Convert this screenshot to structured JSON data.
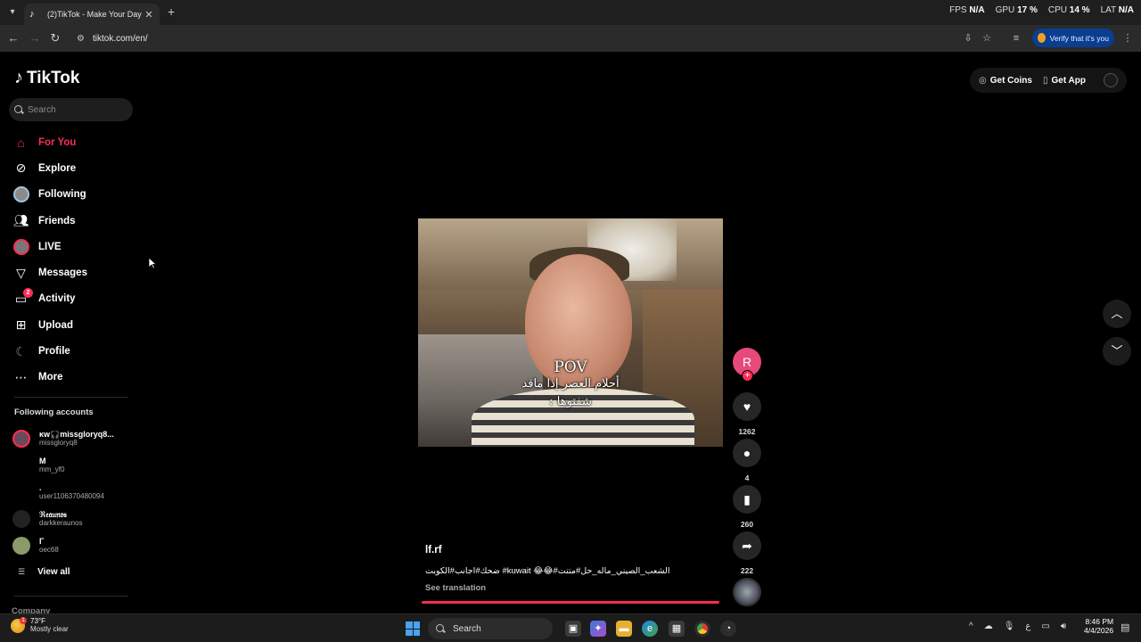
{
  "browser": {
    "tab_title": "(2)TikTok - Make Your Day",
    "url": "tiktok.com/en/",
    "verify_label": "Verify that it's you",
    "perf": [
      {
        "label": "FPS",
        "value": "N/A"
      },
      {
        "label": "GPU",
        "value": "17 %"
      },
      {
        "label": "CPU",
        "value": "14 %"
      },
      {
        "label": "LAT",
        "value": "N/A"
      }
    ]
  },
  "app": {
    "logo_text": "TikTok",
    "search_placeholder": "Search"
  },
  "nav": [
    {
      "label": "For You",
      "icon": "home-icon",
      "active": true
    },
    {
      "label": "Explore",
      "icon": "compass-icon"
    },
    {
      "label": "Following",
      "icon": "following-avatar"
    },
    {
      "label": "Friends",
      "icon": "friends-icon"
    },
    {
      "label": "LIVE",
      "icon": "live-avatar"
    },
    {
      "label": "Messages",
      "icon": "send-icon"
    },
    {
      "label": "Activity",
      "icon": "inbox-icon",
      "badge": "2"
    },
    {
      "label": "Upload",
      "icon": "upload-icon"
    },
    {
      "label": "Profile",
      "icon": "profile-icon"
    },
    {
      "label": "More",
      "icon": "more-icon"
    }
  ],
  "following_accounts": {
    "heading": "Following accounts",
    "items": [
      {
        "name": "ĸw🎧missgloryq8...",
        "user": "missgloryq8"
      },
      {
        "name": "M",
        "user": "mm_yf0"
      },
      {
        "name": ".",
        "user": "user1106370480094"
      },
      {
        "name": "ℜ𝔢𝔞𝔲𝔫𝔬𝔰",
        "user": "darkkeraunos"
      },
      {
        "name": "Γ",
        "user": "oec68"
      }
    ],
    "view_all": "View all"
  },
  "footer_section": "Company",
  "top_actions": {
    "get_coins": "Get Coins",
    "get_app": "Get App"
  },
  "video": {
    "caption_line1": "POV",
    "caption_line2": "أحلام العصر إذا ماقد",
    "caption_line3": "شفتوها :"
  },
  "creator_initial": "R",
  "actions": {
    "likes": "1262",
    "comments": "4",
    "saves": "260",
    "shares": "222"
  },
  "post": {
    "author": "lf.rf",
    "description": "ضحك#اجانب#الكويت #kuwait 😂😂#الشعب_الصيني_ماله_حل#متتت",
    "see_translation": "See translation"
  },
  "taskbar": {
    "weather_temp": "73°F",
    "weather_cond": "Mostly clear",
    "search_label": "Search",
    "time": "8:46 PM",
    "date": "4/4/2026",
    "lang": "ع"
  }
}
